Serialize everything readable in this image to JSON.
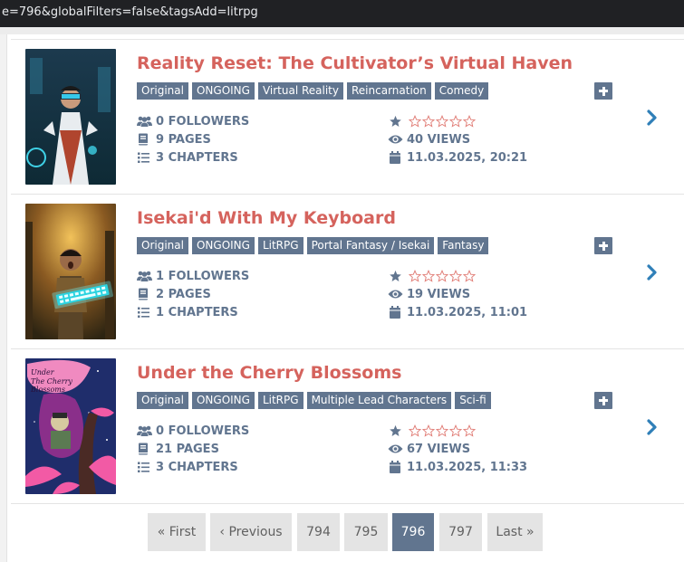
{
  "browser": {
    "url": "e=796&globalFilters=false&tagsAdd=litrpg"
  },
  "fictions": [
    {
      "title": "Reality Reset: The Cultivator’s Virtual Haven",
      "tags": [
        "Original",
        "ONGOING",
        "Virtual Reality",
        "Reincarnation",
        "Comedy"
      ],
      "followers": "0 FOLLOWERS",
      "pages": "9 PAGES",
      "chapters": "3 CHAPTERS",
      "views": "40 VIEWS",
      "date": "11.03.2025, 20:21",
      "rating": 1,
      "cover_icon": "cultivator-vr-cover-image"
    },
    {
      "title": "Isekai'd With My Keyboard",
      "tags": [
        "Original",
        "ONGOING",
        "LitRPG",
        "Portal Fantasy / Isekai",
        "Fantasy"
      ],
      "followers": "1 FOLLOWERS",
      "pages": "2 PAGES",
      "chapters": "1 CHAPTERS",
      "views": "19 VIEWS",
      "date": "11.03.2025, 11:01",
      "rating": 1,
      "cover_icon": "keyboard-hero-cover-image"
    },
    {
      "title": "Under the Cherry Blossoms",
      "tags": [
        "Original",
        "ONGOING",
        "LitRPG",
        "Multiple Lead Characters",
        "Sci-fi"
      ],
      "followers": "0 FOLLOWERS",
      "pages": "21 PAGES",
      "chapters": "3 CHAPTERS",
      "views": "67 VIEWS",
      "date": "11.03.2025, 11:33",
      "rating": 1,
      "cover_icon": "cherry-blossom-cover-image",
      "cover_text": "Under The Cherry Blossoms"
    }
  ],
  "pagination": {
    "first": "« First",
    "previous": "‹ Previous",
    "pages": [
      "794",
      "795",
      "796",
      "797"
    ],
    "current": "796",
    "last": "Last »"
  },
  "colors": {
    "title": "#d5635d",
    "tag_bg": "#61758f",
    "stat_text": "#61758f",
    "pager_bg": "#e4e4e4",
    "pager_active": "#61758f"
  },
  "icons": {
    "followers": "users-icon",
    "pages": "book-icon",
    "chapters": "list-icon",
    "rating": "star-icon",
    "views": "eye-icon",
    "date": "calendar-icon",
    "add_tag": "plus-icon",
    "open": "chevron-right-icon"
  }
}
